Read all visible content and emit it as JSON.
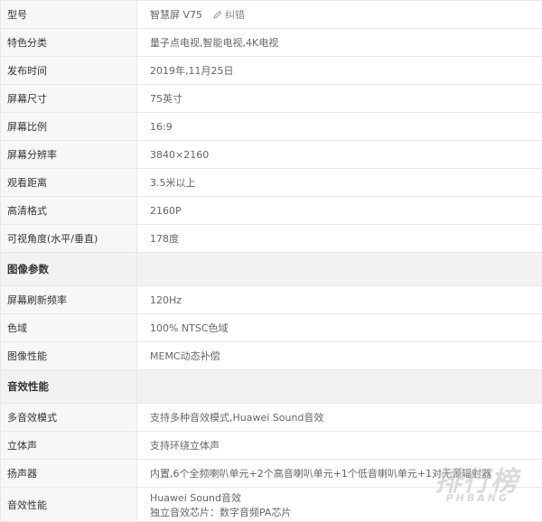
{
  "basic_specs": [
    {
      "label": "型号",
      "value": "智慧屏 V75",
      "correction_label": "纠错"
    },
    {
      "label": "特色分类",
      "value": "量子点电视,智能电视,4K电视"
    },
    {
      "label": "发布时间",
      "value": "2019年,11月25日"
    },
    {
      "label": "屏幕尺寸",
      "value": "75英寸"
    },
    {
      "label": "屏幕比例",
      "value": "16:9"
    },
    {
      "label": "屏幕分辨率",
      "value": "3840×2160"
    },
    {
      "label": "观看距离",
      "value": "3.5米以上"
    },
    {
      "label": "高清格式",
      "value": "2160P"
    },
    {
      "label": "可视角度(水平/垂直)",
      "value": "178度"
    }
  ],
  "image_section": {
    "title": "图像参数",
    "rows": [
      {
        "label": "屏幕刷新频率",
        "value": "120Hz"
      },
      {
        "label": "色域",
        "value": "100% NTSC色域"
      },
      {
        "label": "图像性能",
        "value": "MEMC动态补偿"
      }
    ]
  },
  "audio_section": {
    "title": "音效性能",
    "rows": [
      {
        "label": "多音效模式",
        "value": "支持多种音效模式,Huawei Sound音效"
      },
      {
        "label": "立体声",
        "value": "支持环绕立体声"
      },
      {
        "label": "扬声器",
        "value": "内置,6个全频喇叭单元+2个高音喇叭单元+1个低音喇叭单元+1对无源辐射器"
      },
      {
        "label": "音效性能",
        "value_line1": "Huawei Sound音效",
        "value_line2": "独立音效芯片：数字音频PA芯片"
      }
    ]
  },
  "watermark": {
    "cn": "排行榜",
    "en": "PHBANG"
  },
  "icons": {
    "correction": "pencil-icon"
  },
  "colors": {
    "border": "#e8e8e8",
    "label_bg": "#f7f7f7",
    "section_bg": "#f2f2f2",
    "text": "#333333",
    "value_text": "#666666"
  }
}
